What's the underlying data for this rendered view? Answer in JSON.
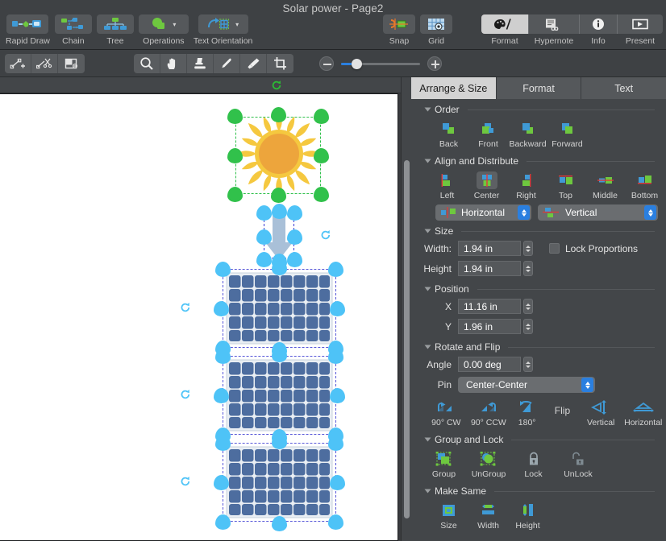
{
  "window": {
    "title": "Solar power - Page2"
  },
  "toolbar": {
    "left_items": [
      {
        "label": "Rapid Draw",
        "icon": "rapid-draw-icon",
        "has_caret": false,
        "active": false
      },
      {
        "label": "Chain",
        "icon": "chain-icon",
        "has_caret": false,
        "active": false
      },
      {
        "label": "Tree",
        "icon": "tree-icon",
        "has_caret": false,
        "active": false
      },
      {
        "label": "Operations",
        "icon": "operations-icon",
        "has_caret": true,
        "active": false
      },
      {
        "label": "Text Orientation",
        "icon": "text-orientation-icon",
        "has_caret": true,
        "active": false
      }
    ],
    "mid_items": [
      {
        "label": "Snap",
        "icon": "snap-icon"
      },
      {
        "label": "Grid",
        "icon": "grid-icon"
      }
    ],
    "right_items": [
      {
        "label": "Format",
        "icon": "palette-icon",
        "active": true
      },
      {
        "label": "Hypernote",
        "icon": "hypernote-icon",
        "active": false
      },
      {
        "label": "Info",
        "icon": "info-icon",
        "active": false
      },
      {
        "label": "Present",
        "icon": "present-icon",
        "active": false
      }
    ]
  },
  "toolbar2": {
    "group_a": [
      "add-point-icon",
      "cut-point-icon",
      "mask-icon"
    ],
    "group_b": [
      "zoom-tool-icon",
      "hand-tool-icon",
      "stamp-tool-icon",
      "eyedropper-tool-icon",
      "brush-tool-icon",
      "crop-tool-icon"
    ],
    "zoom": {
      "minus": "zoom-out-icon",
      "plus": "zoom-in-icon",
      "value_pct": 15
    }
  },
  "inspector": {
    "tabs": [
      {
        "label": "Arrange & Size",
        "active": true
      },
      {
        "label": "Format",
        "active": false
      },
      {
        "label": "Text",
        "active": false
      }
    ],
    "order": {
      "title": "Order",
      "buttons": [
        {
          "label": "Back",
          "icon": "send-to-back-icon"
        },
        {
          "label": "Front",
          "icon": "bring-to-front-icon"
        },
        {
          "label": "Backward",
          "icon": "send-backward-icon"
        },
        {
          "label": "Forward",
          "icon": "bring-forward-icon"
        }
      ]
    },
    "align": {
      "title": "Align and Distribute",
      "buttons": [
        {
          "label": "Left",
          "icon": "align-left-icon",
          "selected": false
        },
        {
          "label": "Center",
          "icon": "align-center-icon",
          "selected": true
        },
        {
          "label": "Right",
          "icon": "align-right-icon",
          "selected": false
        },
        {
          "label": "Top",
          "icon": "align-top-icon",
          "selected": false
        },
        {
          "label": "Middle",
          "icon": "align-middle-icon",
          "selected": false
        },
        {
          "label": "Bottom",
          "icon": "align-bottom-icon",
          "selected": false
        }
      ],
      "distribute_horizontal": "Horizontal",
      "distribute_vertical": "Vertical"
    },
    "size": {
      "title": "Size",
      "width_label": "Width:",
      "width_value": "1.94 in",
      "height_label": "Height",
      "height_value": "1.94 in",
      "lock_proportions_label": "Lock Proportions",
      "lock_proportions_checked": false
    },
    "position": {
      "title": "Position",
      "x_label": "X",
      "x_value": "11.16 in",
      "y_label": "Y",
      "y_value": "1.96 in"
    },
    "rotate": {
      "title": "Rotate and Flip",
      "angle_label": "Angle",
      "angle_value": "0.00 deg",
      "pin_label": "Pin",
      "pin_value": "Center-Center",
      "buttons": [
        {
          "label": "90° CW",
          "icon": "rotate-cw-icon"
        },
        {
          "label": "90° CCW",
          "icon": "rotate-ccw-icon"
        },
        {
          "label": "180°",
          "icon": "rotate-180-icon"
        }
      ],
      "flip_label": "Flip",
      "flip_buttons": [
        {
          "label": "Vertical",
          "icon": "flip-vertical-icon"
        },
        {
          "label": "Horizontal",
          "icon": "flip-horizontal-icon"
        }
      ]
    },
    "group_lock": {
      "title": "Group and Lock",
      "buttons": [
        {
          "label": "Group",
          "icon": "group-icon"
        },
        {
          "label": "UnGroup",
          "icon": "ungroup-icon"
        },
        {
          "label": "Lock",
          "icon": "lock-icon"
        },
        {
          "label": "UnLock",
          "icon": "unlock-icon"
        }
      ]
    },
    "make_same": {
      "title": "Make Same",
      "buttons": [
        {
          "label": "Size",
          "icon": "make-same-size-icon"
        },
        {
          "label": "Width",
          "icon": "make-same-width-icon"
        },
        {
          "label": "Height",
          "icon": "make-same-height-icon"
        }
      ]
    }
  },
  "canvas": {
    "refresh_icon": "refresh-icon",
    "shapes": [
      {
        "name": "sun",
        "selected": true,
        "handle_color": "#31c14b"
      },
      {
        "name": "arrow-down",
        "selected": true,
        "handle_color": "#4ec3f7"
      },
      {
        "name": "solar-panel-1",
        "selected": true,
        "handle_color": "#4ec3f7"
      },
      {
        "name": "solar-panel-2",
        "selected": true,
        "handle_color": "#4ec3f7"
      },
      {
        "name": "solar-panel-3",
        "selected": true,
        "handle_color": "#4ec3f7"
      }
    ]
  },
  "colors": {
    "accent_blue": "#2a7fe0",
    "handle_green": "#31c14b",
    "handle_blue": "#4ec3f7",
    "panel_cell": "#4a6a9e",
    "sun_outer": "#f4c842",
    "sun_inner": "#f0a93c",
    "selection_green": "#2fc04a",
    "selection_blue": "#5656d8",
    "toolbar_bg": "#3e4144",
    "inspector_bg": "#434649"
  }
}
